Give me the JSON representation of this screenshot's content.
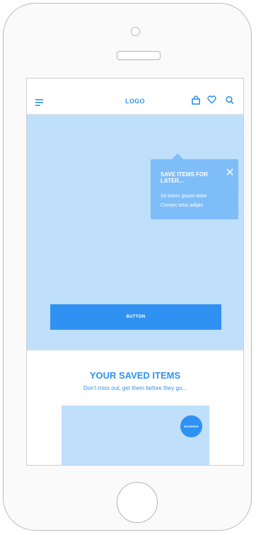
{
  "navbar": {
    "logo": "LOGO",
    "icons": [
      "menu-icon",
      "shopping-bag-icon",
      "heart-icon",
      "search-icon"
    ]
  },
  "hero": {
    "button_label": "BUTTON"
  },
  "tooltip": {
    "title": "SAVE ITEMS FOR LATER...",
    "line1": "Sit lorem ipsum dolor",
    "line2": "Consec tetur adipis",
    "close_icon": "close-icon"
  },
  "saved": {
    "title": "YOUR SAVED ITEMS",
    "subtitle": "Don't miss out, get them before they go...",
    "badge": "BOOKEDS"
  },
  "colors": {
    "accent": "#2f92f2",
    "light_fill": "#bfdffa",
    "tooltip_bg": "#7ebdf8"
  }
}
